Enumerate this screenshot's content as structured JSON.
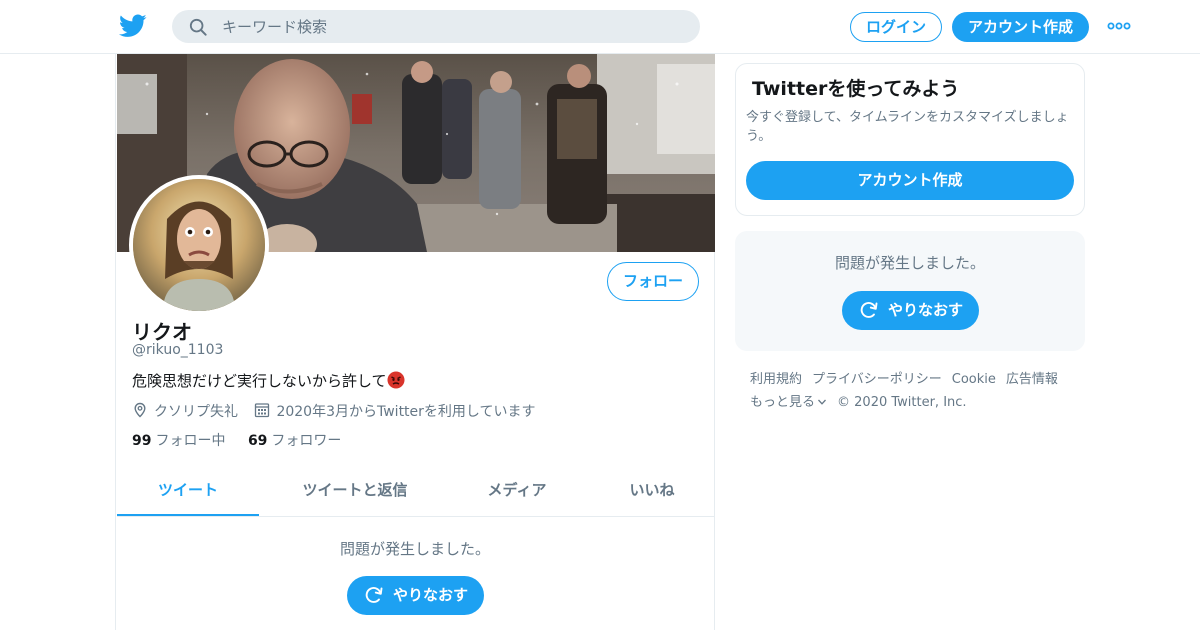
{
  "colors": {
    "accent": "#1da1f2",
    "muted": "#657786",
    "text": "#14171a",
    "divider": "#e6ecf0"
  },
  "header": {
    "search_placeholder": "キーワード検索",
    "login_label": "ログイン",
    "signup_label": "アカウント作成",
    "icons": [
      "twitter-bird-icon",
      "search-icon",
      "more-dots-icon"
    ]
  },
  "profile": {
    "name": "リクオ",
    "handle": "@rikuo_1103",
    "bio": "危険思想だけど実行しないから許して",
    "location": "クソリプ失礼",
    "joined": "2020年3月からTwitterを利用しています",
    "following_count": "99",
    "following_label": "フォロー中",
    "followers_count": "69",
    "followers_label": "フォロワー",
    "follow_label": "フォロー"
  },
  "tabs": [
    {
      "label": "ツイート",
      "active": true
    },
    {
      "label": "ツイートと返信",
      "active": false
    },
    {
      "label": "メディア",
      "active": false
    },
    {
      "label": "いいね",
      "active": false
    }
  ],
  "timeline": {
    "error_text": "問題が発生しました。",
    "retry_label": "やりなおす"
  },
  "sidebar": {
    "card_title": "Twitterを使ってみよう",
    "card_desc": "今すぐ登録して、タイムラインをカスタマイズしましょう。",
    "card_signup_label": "アカウント作成",
    "error_text": "問題が発生しました。",
    "retry_label": "やりなおす"
  },
  "footer": {
    "links": [
      "利用規約",
      "プライバシーポリシー",
      "Cookie",
      "広告情報"
    ],
    "more_label": "もっと見る",
    "copyright": "© 2020 Twitter, Inc."
  }
}
